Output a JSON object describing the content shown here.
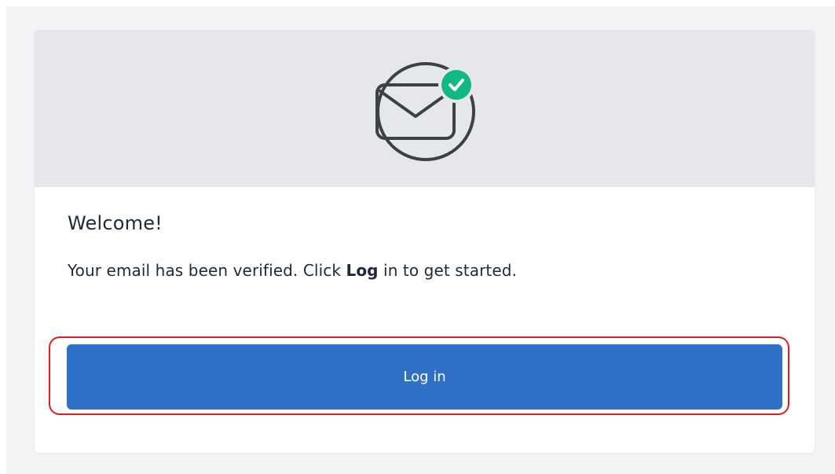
{
  "card": {
    "hero_icon": "envelope-check-icon",
    "title": "Welcome!",
    "message_prefix": "Your email has been verified. Click ",
    "message_emphasis": "Log",
    "message_suffix": " in to get started.",
    "login_button": "Log in"
  },
  "colors": {
    "primary": "#2f71c8",
    "success": "#10b981",
    "highlight": "#e11d1d",
    "hero_background": "#e5e7eb"
  }
}
